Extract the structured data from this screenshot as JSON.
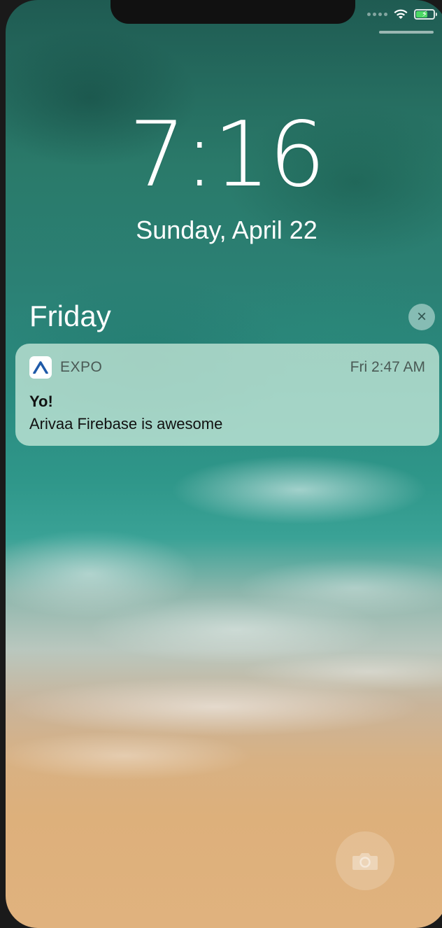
{
  "lock_screen": {
    "time": "7:16",
    "date": "Sunday, April 22",
    "section_header": "Friday",
    "clear_label": "×"
  },
  "status_bar": {
    "battery_charging": true,
    "battery_level": 0.6,
    "battery_color": "#4cd964"
  },
  "notification": {
    "app_name": "EXPO",
    "app_icon": "expo-logo-icon",
    "time": "Fri 2:47 AM",
    "title": "Yo!",
    "body": "Arivaa Firebase is awesome"
  },
  "controls": {
    "camera_icon": "camera-icon"
  }
}
